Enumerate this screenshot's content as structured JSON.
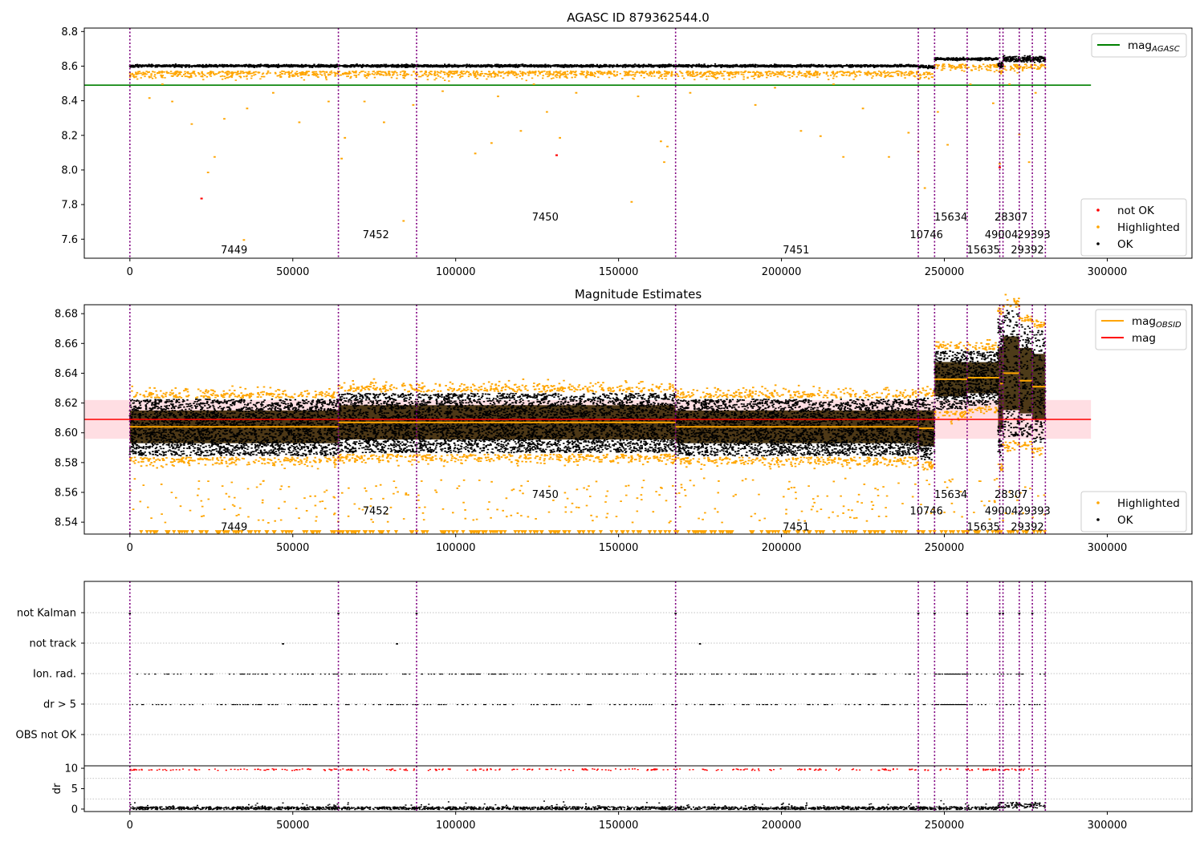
{
  "chart_data": [
    {
      "type": "scatter",
      "title": "AGASC ID 879362544.0",
      "xlim": [
        -14000,
        326000
      ],
      "ylim": [
        7.49,
        8.82
      ],
      "xticks": [
        0,
        50000,
        100000,
        150000,
        200000,
        250000,
        300000
      ],
      "xtick_labels": [
        "0",
        "50000",
        "100000",
        "150000",
        "200000",
        "250000",
        "300000"
      ],
      "yticks": [
        7.6,
        7.8,
        8.0,
        8.2,
        8.4,
        8.6,
        8.8
      ],
      "ytick_labels": [
        "7.6",
        "7.8",
        "8.0",
        "8.2",
        "8.4",
        "8.6",
        "8.8"
      ],
      "obsid_boundaries": [
        0,
        64000,
        88000,
        167500,
        242000,
        247000,
        257000,
        267000,
        268000,
        273000,
        277000,
        281000
      ],
      "annotations": [
        {
          "text": "7449",
          "x": 32000,
          "y": 7.54
        },
        {
          "text": "7452",
          "x": 75500,
          "y": 7.63
        },
        {
          "text": "7450",
          "x": 127500,
          "y": 7.73
        },
        {
          "text": "7451",
          "x": 204500,
          "y": 7.54
        },
        {
          "text": "10746",
          "x": 244500,
          "y": 7.63
        },
        {
          "text": "15634",
          "x": 252000,
          "y": 7.73
        },
        {
          "text": "15635",
          "x": 262000,
          "y": 7.54
        },
        {
          "text": "49004",
          "x": 267500,
          "y": 7.63
        },
        {
          "text": "28307",
          "x": 270500,
          "y": 7.73
        },
        {
          "text": "29392",
          "x": 275500,
          "y": 7.54
        },
        {
          "text": "29393",
          "x": 277500,
          "y": 7.63
        }
      ],
      "mag_agasc": 8.49,
      "segments": [
        {
          "x0": 0,
          "x1": 242000,
          "level": 8.605,
          "spread": 0.018
        },
        {
          "x0": 242000,
          "x1": 247000,
          "level": 8.6,
          "spread": 0.02
        },
        {
          "x0": 247000,
          "x1": 266500,
          "level": 8.645,
          "spread": 0.018
        },
        {
          "x0": 266500,
          "x1": 268000,
          "level": 8.61,
          "spread": 0.04
        },
        {
          "x0": 268000,
          "x1": 281000,
          "level": 8.645,
          "spread": 0.045
        }
      ],
      "highlighted_outliers": [
        [
          6000,
          8.42
        ],
        [
          10000,
          8.5
        ],
        [
          13000,
          8.4
        ],
        [
          19000,
          8.27
        ],
        [
          24000,
          7.99
        ],
        [
          26000,
          8.08
        ],
        [
          29000,
          8.3
        ],
        [
          35000,
          7.6
        ],
        [
          36000,
          8.36
        ],
        [
          44000,
          8.45
        ],
        [
          52000,
          8.28
        ],
        [
          61000,
          8.4
        ],
        [
          65000,
          8.07
        ],
        [
          66000,
          8.19
        ],
        [
          72000,
          8.4
        ],
        [
          78000,
          8.28
        ],
        [
          84000,
          7.71
        ],
        [
          87000,
          8.38
        ],
        [
          96000,
          8.46
        ],
        [
          106000,
          8.1
        ],
        [
          111000,
          8.16
        ],
        [
          113000,
          8.43
        ],
        [
          120000,
          8.23
        ],
        [
          124000,
          8.5
        ],
        [
          128000,
          8.34
        ],
        [
          132000,
          8.19
        ],
        [
          137000,
          8.45
        ],
        [
          154000,
          7.82
        ],
        [
          156000,
          8.43
        ],
        [
          163000,
          8.17
        ],
        [
          164000,
          8.05
        ],
        [
          165000,
          8.14
        ],
        [
          172000,
          8.45
        ],
        [
          184000,
          8.55
        ],
        [
          192000,
          8.38
        ],
        [
          198000,
          8.48
        ],
        [
          206000,
          8.23
        ],
        [
          212000,
          8.2
        ],
        [
          216000,
          8.5
        ],
        [
          219000,
          8.08
        ],
        [
          225000,
          8.36
        ],
        [
          233000,
          8.08
        ],
        [
          239000,
          8.22
        ],
        [
          242000,
          8.11
        ],
        [
          244000,
          7.9
        ],
        [
          248000,
          8.34
        ],
        [
          251000,
          8.15
        ],
        [
          258000,
          8.5
        ],
        [
          265000,
          8.39
        ],
        [
          267000,
          8.04
        ],
        [
          270000,
          8.5
        ],
        [
          273000,
          8.21
        ],
        [
          276000,
          8.05
        ],
        [
          278000,
          8.45
        ]
      ],
      "not_ok_points": [
        [
          22000,
          7.84
        ],
        [
          131000,
          8.09
        ],
        [
          267000,
          8.02
        ]
      ],
      "legends": [
        {
          "position": "upper-right",
          "entries": [
            {
              "label": "mag",
              "sub": "AGASC",
              "style": "line",
              "color": "#008000"
            }
          ]
        },
        {
          "position": "lower-right",
          "entries": [
            {
              "label": "not OK",
              "style": "dot",
              "color": "#ff0000"
            },
            {
              "label": "Highlighted",
              "style": "dot",
              "color": "#ffa500"
            },
            {
              "label": "OK",
              "style": "dot",
              "color": "#000000"
            }
          ]
        }
      ]
    },
    {
      "type": "scatter",
      "title": "Magnitude Estimates",
      "xlim": [
        -14000,
        326000
      ],
      "ylim": [
        8.532,
        8.686
      ],
      "xticks": [
        0,
        50000,
        100000,
        150000,
        200000,
        250000,
        300000
      ],
      "xtick_labels": [
        "0",
        "50000",
        "100000",
        "150000",
        "200000",
        "250000",
        "300000"
      ],
      "yticks": [
        8.54,
        8.56,
        8.58,
        8.6,
        8.62,
        8.64,
        8.66,
        8.68
      ],
      "ytick_labels": [
        "8.54",
        "8.56",
        "8.58",
        "8.60",
        "8.62",
        "8.64",
        "8.66",
        "8.68"
      ],
      "obsid_boundaries": [
        0,
        64000,
        88000,
        167500,
        242000,
        247000,
        257000,
        267000,
        268000,
        273000,
        277000,
        281000
      ],
      "annotations": [
        {
          "text": "7449",
          "x": 32000,
          "y": 8.537
        },
        {
          "text": "7452",
          "x": 75500,
          "y": 8.548
        },
        {
          "text": "7450",
          "x": 127500,
          "y": 8.559
        },
        {
          "text": "7451",
          "x": 204500,
          "y": 8.537
        },
        {
          "text": "10746",
          "x": 244500,
          "y": 8.548
        },
        {
          "text": "15634",
          "x": 252000,
          "y": 8.559
        },
        {
          "text": "15635",
          "x": 262000,
          "y": 8.537
        },
        {
          "text": "49004",
          "x": 267500,
          "y": 8.548
        },
        {
          "text": "28307",
          "x": 270500,
          "y": 8.559
        },
        {
          "text": "29392",
          "x": 275500,
          "y": 8.537
        },
        {
          "text": "29393",
          "x": 277500,
          "y": 8.548
        }
      ],
      "mag": 8.609,
      "mag_band": [
        8.596,
        8.622
      ],
      "mag_obsid": [
        {
          "x0": 0,
          "x1": 64000,
          "value": 8.604
        },
        {
          "x0": 64000,
          "x1": 88000,
          "value": 8.607
        },
        {
          "x0": 88000,
          "x1": 167500,
          "value": 8.607
        },
        {
          "x0": 167500,
          "x1": 242000,
          "value": 8.604
        },
        {
          "x0": 242000,
          "x1": 247000,
          "value": 8.603
        },
        {
          "x0": 247000,
          "x1": 257000,
          "value": 8.636
        },
        {
          "x0": 257000,
          "x1": 267000,
          "value": 8.637
        },
        {
          "x0": 267000,
          "x1": 268000,
          "value": 8.633
        },
        {
          "x0": 268000,
          "x1": 273000,
          "value": 8.64
        },
        {
          "x0": 273000,
          "x1": 277000,
          "value": 8.635
        },
        {
          "x0": 277000,
          "x1": 281000,
          "value": 8.631
        }
      ],
      "segments": [
        {
          "x0": 0,
          "x1": 64000,
          "center": 8.604,
          "half": 0.02
        },
        {
          "x0": 64000,
          "x1": 88000,
          "center": 8.607,
          "half": 0.021
        },
        {
          "x0": 88000,
          "x1": 167500,
          "center": 8.607,
          "half": 0.021
        },
        {
          "x0": 167500,
          "x1": 242000,
          "center": 8.604,
          "half": 0.02
        },
        {
          "x0": 242000,
          "x1": 247000,
          "center": 8.603,
          "half": 0.022
        },
        {
          "x0": 247000,
          "x1": 257000,
          "center": 8.636,
          "half": 0.021
        },
        {
          "x0": 257000,
          "x1": 266500,
          "center": 8.637,
          "half": 0.019
        },
        {
          "x0": 266500,
          "x1": 268000,
          "center": 8.63,
          "half": 0.05
        },
        {
          "x0": 268000,
          "x1": 273000,
          "center": 8.64,
          "half": 0.045
        },
        {
          "x0": 273000,
          "x1": 277000,
          "center": 8.635,
          "half": 0.04
        },
        {
          "x0": 277000,
          "x1": 281000,
          "center": 8.631,
          "half": 0.04
        }
      ],
      "low_clipped_value": 8.533,
      "legends": [
        {
          "position": "upper-right",
          "entries": [
            {
              "label": "mag",
              "sub": "OBSID",
              "style": "line",
              "color": "#ffa500"
            },
            {
              "label": "mag",
              "style": "line",
              "color": "#ff0000"
            }
          ]
        },
        {
          "position": "lower-right",
          "entries": [
            {
              "label": "Highlighted",
              "style": "dot",
              "color": "#ffa500"
            },
            {
              "label": "OK",
              "style": "dot",
              "color": "#000000"
            }
          ]
        }
      ]
    },
    {
      "type": "scatter",
      "title": "",
      "xlim": [
        -14000,
        326000
      ],
      "flag_rows": [
        "not Kalman",
        "not track",
        "Ion. rad.",
        "dr > 5",
        "OBS not OK"
      ],
      "obsid_boundaries": [
        0,
        64000,
        88000,
        167500,
        242000,
        247000,
        257000,
        267000,
        268000,
        273000,
        277000,
        281000
      ],
      "flags": {
        "not Kalman": [
          0,
          64000,
          88000,
          167500,
          242000,
          247000,
          257000,
          267000,
          268000,
          273000,
          277000
        ],
        "not track": [
          47000,
          82000,
          175000
        ],
        "Ion. rad.": "sparse",
        "dr > 5": "sparse",
        "OBS not OK": []
      }
    },
    {
      "type": "scatter",
      "title": "",
      "ylabel": "dr",
      "xlim": [
        -14000,
        326000
      ],
      "ylim": [
        -0.6,
        10.6
      ],
      "yticks": [
        0,
        5,
        10
      ],
      "ytick_labels": [
        "0",
        "5",
        "10"
      ],
      "xticks": [
        0,
        50000,
        100000,
        150000,
        200000,
        250000,
        300000
      ],
      "xtick_labels": [
        "0",
        "50000",
        "100000",
        "150000",
        "200000",
        "250000",
        "300000"
      ],
      "obsid_boundaries": [
        0,
        64000,
        88000,
        167500,
        242000,
        247000,
        257000,
        267000,
        268000,
        273000,
        277000,
        281000
      ],
      "clip_value": 10
    }
  ]
}
